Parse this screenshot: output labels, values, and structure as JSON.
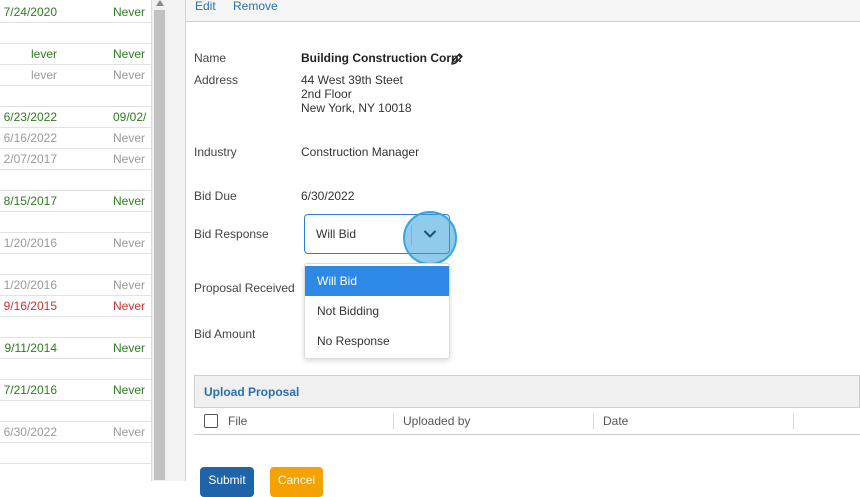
{
  "left_list": {
    "rows": [
      {
        "date": "7/24/2020",
        "status": "Never",
        "color": "green"
      },
      {
        "date": "",
        "status": "",
        "color": "green"
      },
      {
        "date": "lever",
        "status": "Never",
        "color": "green"
      },
      {
        "date": "lever",
        "status": "Never",
        "color": "gray"
      },
      {
        "date": "",
        "status": "",
        "color": "gray"
      },
      {
        "date": "6/23/2022",
        "status": "09/02/",
        "color": "green"
      },
      {
        "date": "6/16/2022",
        "status": "Never",
        "color": "gray"
      },
      {
        "date": "2/07/2017",
        "status": "Never",
        "color": "gray"
      },
      {
        "date": "",
        "status": "",
        "color": "gray"
      },
      {
        "date": "8/15/2017",
        "status": "Never",
        "color": "green"
      },
      {
        "date": "",
        "status": "",
        "color": "gray"
      },
      {
        "date": "1/20/2016",
        "status": "Never",
        "color": "gray"
      },
      {
        "date": "",
        "status": "",
        "color": "gray"
      },
      {
        "date": "1/20/2016",
        "status": "Never",
        "color": "gray"
      },
      {
        "date": "9/16/2015",
        "status": "Never",
        "color": "red"
      },
      {
        "date": "",
        "status": "",
        "color": "gray"
      },
      {
        "date": "9/11/2014",
        "status": "Never",
        "color": "green"
      },
      {
        "date": "",
        "status": "",
        "color": "gray"
      },
      {
        "date": "7/21/2016",
        "status": "Never",
        "color": "green"
      },
      {
        "date": "",
        "status": "",
        "color": "gray"
      },
      {
        "date": "6/30/2022",
        "status": "Never",
        "color": "gray"
      },
      {
        "date": "",
        "status": "",
        "color": "gray"
      }
    ]
  },
  "toolbar": {
    "edit_label": "Edit",
    "remove_label": "Remove"
  },
  "details": {
    "name_label": "Name",
    "name_value": "Building Construction Corp.",
    "address_label": "Address",
    "address_line1": "44 West 39th Steet",
    "address_line2": "2nd Floor",
    "address_line3": "New York, NY 10018",
    "industry_label": "Industry",
    "industry_value": "Construction Manager",
    "bid_due_label": "Bid Due",
    "bid_due_value": "6/30/2022",
    "bid_response_label": "Bid Response",
    "proposal_received_label": "Proposal Received",
    "bid_amount_label": "Bid Amount"
  },
  "bid_response_select": {
    "selected": "Will Bid",
    "options": [
      "Will Bid",
      "Not Bidding",
      "No Response"
    ],
    "highlighted_index": 0
  },
  "upload": {
    "title": "Upload Proposal",
    "columns": [
      "File",
      "Uploaded by",
      "Date"
    ]
  },
  "buttons": {
    "submit_label": "Submit",
    "cancel_label": "Cancel"
  },
  "colors": {
    "link": "#2a6fb0",
    "accent": "#2d88e6",
    "submit": "#1f63a8",
    "cancel": "#f5a100",
    "green": "#2e7d1e",
    "red": "#d32f2f",
    "gray": "#9a9a9a"
  },
  "icons": {
    "edit": "pencil-icon",
    "dropdown": "chevron-down-icon"
  }
}
